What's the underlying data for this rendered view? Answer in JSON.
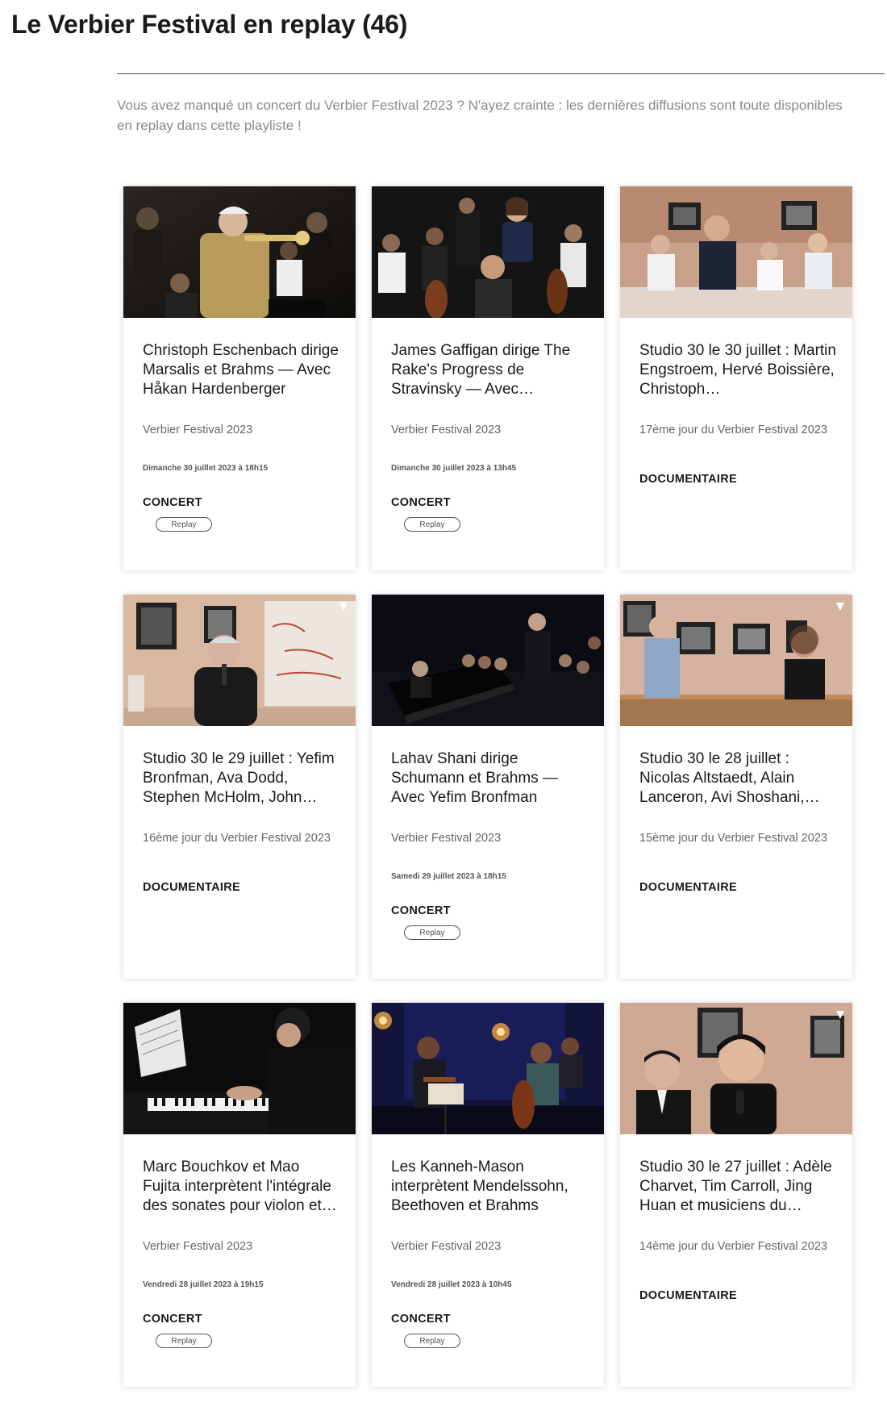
{
  "page": {
    "title": "Le Verbier Festival en replay (46)",
    "description": "Vous avez manqué un concert du Verbier Festival 2023 ? N'ayez crainte : les dernières diffusions sont toute disponibles en replay dans cette playliste !"
  },
  "cards": [
    {
      "title": "Christoph Eschenbach dirige Marsalis et Brahms — Avec Håkan Hardenberger",
      "subtitle": "Verbier Festival 2023",
      "date": "Dimanche 30 juillet 2023 à 18h15",
      "category": "CONCERT",
      "button": "Replay",
      "thumb_icon": "orchestra-trumpet-image"
    },
    {
      "title": "James Gaffigan dirige The Rake's Progress de Stravinsky — Avec…",
      "subtitle": "Verbier Festival 2023",
      "date": "Dimanche 30 juillet 2023 à 13h45",
      "category": "CONCERT",
      "button": "Replay",
      "thumb_icon": "opera-stage-image"
    },
    {
      "title": "Studio 30 le 30 juillet : Martin Engstroem, Hervé Boissière, Christoph…",
      "subtitle": "17ème jour du Verbier Festival 2023",
      "category": "DOCUMENTAIRE",
      "thumb_icon": "studio-applause-image"
    },
    {
      "title": "Studio 30 le 29 juillet : Yefim Bronfman, Ava Dodd, Stephen McHolm, John…",
      "subtitle": "16ème jour du Verbier Festival 2023",
      "category": "DOCUMENTAIRE",
      "thumb_icon": "studio-interview-image"
    },
    {
      "title": "Lahav Shani dirige Schumann et Brahms — Avec Yefim Bronfman",
      "subtitle": "Verbier Festival 2023",
      "date": "Samedi 29 juillet 2023 à 18h15",
      "category": "CONCERT",
      "button": "Replay",
      "thumb_icon": "piano-orchestra-image"
    },
    {
      "title": "Studio 30 le 28 juillet : Nicolas Altstaedt, Alain Lanceron, Avi Shoshani,…",
      "subtitle": "15ème jour du Verbier Festival 2023",
      "category": "DOCUMENTAIRE",
      "thumb_icon": "studio-conversation-image"
    },
    {
      "title": "Marc Bouchkov et Mao Fujita interprètent l'intégrale des sonates pour violon et…",
      "subtitle": "Verbier Festival 2023",
      "date": "Vendredi 28 juillet 2023 à 19h15",
      "category": "CONCERT",
      "button": "Replay",
      "thumb_icon": "pianist-image"
    },
    {
      "title": "Les Kanneh-Mason interprètent Mendelssohn, Beethoven et Brahms",
      "subtitle": "Verbier Festival 2023",
      "date": "Vendredi 28 juillet 2023 à 10h45",
      "category": "CONCERT",
      "button": "Replay",
      "thumb_icon": "chamber-trio-image"
    },
    {
      "title": "Studio 30 le 27 juillet : Adèle Charvet, Tim Carroll, Jing Huan et musiciens du…",
      "subtitle": "14ème jour du Verbier Festival 2023",
      "category": "DOCUMENTAIRE",
      "thumb_icon": "studio-singer-image"
    }
  ]
}
